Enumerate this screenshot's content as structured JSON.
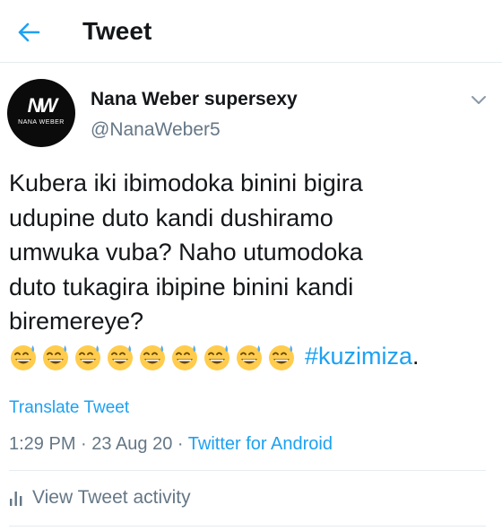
{
  "header": {
    "back_icon": "arrow-left-icon",
    "title": "Tweet",
    "accent_color": "#1da1f2"
  },
  "author": {
    "avatar_mark": "NW",
    "avatar_text": "NANA WEBER",
    "display_name": "Nana Weber supersexy",
    "handle": "@NanaWeber5",
    "menu_icon": "chevron-down-icon"
  },
  "tweet": {
    "lines": [
      "Kubera iki ibimodoka binini bigira",
      "udupine duto kandi dushiramo",
      "umwuka vuba?  Naho utumodoka",
      "duto tukagira ibipine binini kandi",
      "biremereye?"
    ],
    "emoji_name": "grinning-face-with-sweat-icon",
    "emoji_count": 9,
    "hashtag": "#kuzimiza",
    "trailing": "."
  },
  "translate_label": "Translate Tweet",
  "meta": {
    "time": "1:29 PM",
    "date": "23 Aug 20",
    "separator": " · ",
    "source": "Twitter for Android"
  },
  "activity": {
    "icon": "bar-chart-icon",
    "label": "View Tweet activity"
  }
}
